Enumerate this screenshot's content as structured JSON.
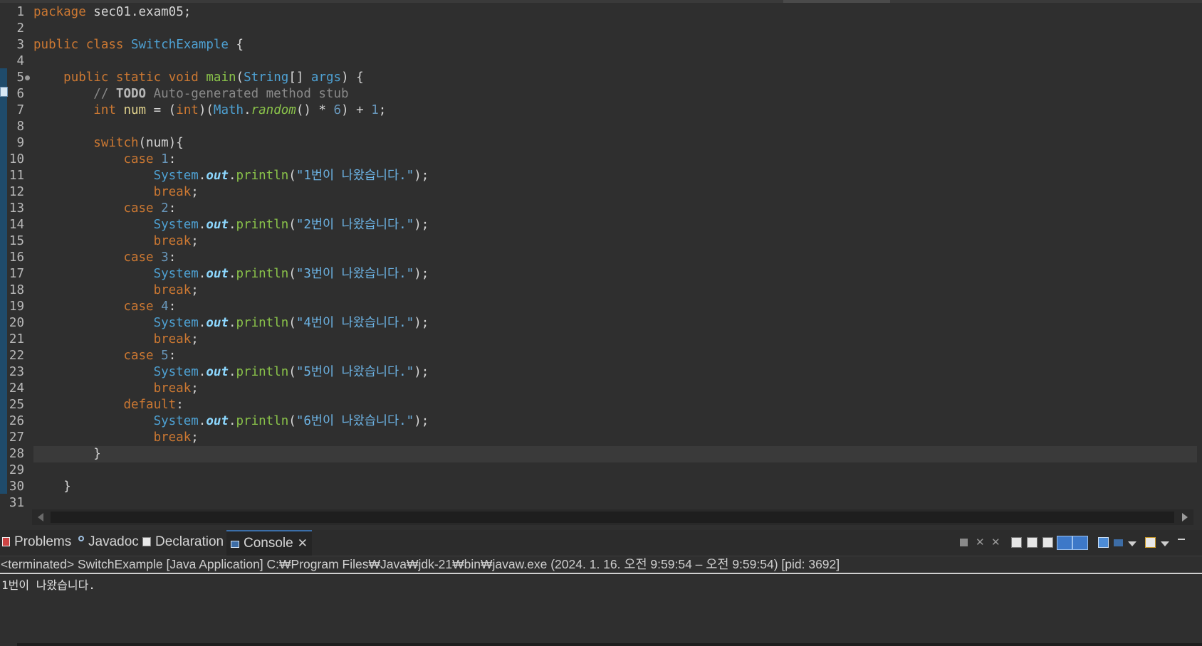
{
  "editor": {
    "lines": [
      {
        "n": "1",
        "tokens": [
          [
            "kw",
            "package"
          ],
          [
            "pl",
            " sec01.exam05;"
          ]
        ]
      },
      {
        "n": "2",
        "tokens": []
      },
      {
        "n": "3",
        "tokens": [
          [
            "kw",
            "public"
          ],
          [
            "pl",
            " "
          ],
          [
            "kw",
            "class"
          ],
          [
            "pl",
            " "
          ],
          [
            "cls",
            "SwitchExample"
          ],
          [
            "pl",
            " {"
          ]
        ]
      },
      {
        "n": "4",
        "tokens": []
      },
      {
        "n": "5",
        "marker": true,
        "tokens": [
          [
            "pl",
            "    "
          ],
          [
            "kw",
            "public"
          ],
          [
            "pl",
            " "
          ],
          [
            "kw",
            "static"
          ],
          [
            "pl",
            " "
          ],
          [
            "kw",
            "void"
          ],
          [
            "pl",
            " "
          ],
          [
            "meth",
            "main"
          ],
          [
            "pl",
            "("
          ],
          [
            "cls",
            "String"
          ],
          [
            "pl",
            "[] "
          ],
          [
            "cls",
            "args"
          ],
          [
            "pl",
            ") {"
          ]
        ]
      },
      {
        "n": "6",
        "tokens": [
          [
            "pl",
            "        "
          ],
          [
            "cmt",
            "// "
          ],
          [
            "todo",
            "TODO"
          ],
          [
            "cmt",
            " Auto-generated method stub"
          ]
        ]
      },
      {
        "n": "7",
        "tokens": [
          [
            "pl",
            "        "
          ],
          [
            "kw",
            "int"
          ],
          [
            "pl",
            " "
          ],
          [
            "var",
            "num"
          ],
          [
            "pl",
            " = ("
          ],
          [
            "kw",
            "int"
          ],
          [
            "pl",
            ")("
          ],
          [
            "cls",
            "Math"
          ],
          [
            "pl",
            "."
          ],
          [
            "smeth",
            "random"
          ],
          [
            "pl",
            "() * "
          ],
          [
            "num",
            "6"
          ],
          [
            "pl",
            ") + "
          ],
          [
            "num",
            "1"
          ],
          [
            "pl",
            ";"
          ]
        ]
      },
      {
        "n": "8",
        "tokens": []
      },
      {
        "n": "9",
        "tokens": [
          [
            "pl",
            "        "
          ],
          [
            "kw",
            "switch"
          ],
          [
            "pl",
            "(num){"
          ]
        ]
      },
      {
        "n": "10",
        "tokens": [
          [
            "pl",
            "            "
          ],
          [
            "kw",
            "case"
          ],
          [
            "pl",
            " "
          ],
          [
            "num",
            "1"
          ],
          [
            "pl",
            ":"
          ]
        ]
      },
      {
        "n": "11",
        "tokens": [
          [
            "pl",
            "                "
          ],
          [
            "cls",
            "System"
          ],
          [
            "pl",
            "."
          ],
          [
            "fld",
            "out"
          ],
          [
            "pl",
            "."
          ],
          [
            "meth",
            "println"
          ],
          [
            "pl",
            "("
          ],
          [
            "str",
            "\"1번이 나왔습니다.\""
          ],
          [
            "pl",
            ");"
          ]
        ]
      },
      {
        "n": "12",
        "tokens": [
          [
            "pl",
            "                "
          ],
          [
            "kw",
            "break"
          ],
          [
            "pl",
            ";"
          ]
        ]
      },
      {
        "n": "13",
        "tokens": [
          [
            "pl",
            "            "
          ],
          [
            "kw",
            "case"
          ],
          [
            "pl",
            " "
          ],
          [
            "num",
            "2"
          ],
          [
            "pl",
            ":"
          ]
        ]
      },
      {
        "n": "14",
        "tokens": [
          [
            "pl",
            "                "
          ],
          [
            "cls",
            "System"
          ],
          [
            "pl",
            "."
          ],
          [
            "fld",
            "out"
          ],
          [
            "pl",
            "."
          ],
          [
            "meth",
            "println"
          ],
          [
            "pl",
            "("
          ],
          [
            "str",
            "\"2번이 나왔습니다.\""
          ],
          [
            "pl",
            ");"
          ]
        ]
      },
      {
        "n": "15",
        "tokens": [
          [
            "pl",
            "                "
          ],
          [
            "kw",
            "break"
          ],
          [
            "pl",
            ";"
          ]
        ]
      },
      {
        "n": "16",
        "tokens": [
          [
            "pl",
            "            "
          ],
          [
            "kw",
            "case"
          ],
          [
            "pl",
            " "
          ],
          [
            "num",
            "3"
          ],
          [
            "pl",
            ":"
          ]
        ]
      },
      {
        "n": "17",
        "tokens": [
          [
            "pl",
            "                "
          ],
          [
            "cls",
            "System"
          ],
          [
            "pl",
            "."
          ],
          [
            "fld",
            "out"
          ],
          [
            "pl",
            "."
          ],
          [
            "meth",
            "println"
          ],
          [
            "pl",
            "("
          ],
          [
            "str",
            "\"3번이 나왔습니다.\""
          ],
          [
            "pl",
            ");"
          ]
        ]
      },
      {
        "n": "18",
        "tokens": [
          [
            "pl",
            "                "
          ],
          [
            "kw",
            "break"
          ],
          [
            "pl",
            ";"
          ]
        ]
      },
      {
        "n": "19",
        "tokens": [
          [
            "pl",
            "            "
          ],
          [
            "kw",
            "case"
          ],
          [
            "pl",
            " "
          ],
          [
            "num",
            "4"
          ],
          [
            "pl",
            ":"
          ]
        ]
      },
      {
        "n": "20",
        "tokens": [
          [
            "pl",
            "                "
          ],
          [
            "cls",
            "System"
          ],
          [
            "pl",
            "."
          ],
          [
            "fld",
            "out"
          ],
          [
            "pl",
            "."
          ],
          [
            "meth",
            "println"
          ],
          [
            "pl",
            "("
          ],
          [
            "str",
            "\"4번이 나왔습니다.\""
          ],
          [
            "pl",
            ");"
          ]
        ]
      },
      {
        "n": "21",
        "tokens": [
          [
            "pl",
            "                "
          ],
          [
            "kw",
            "break"
          ],
          [
            "pl",
            ";"
          ]
        ]
      },
      {
        "n": "22",
        "tokens": [
          [
            "pl",
            "            "
          ],
          [
            "kw",
            "case"
          ],
          [
            "pl",
            " "
          ],
          [
            "num",
            "5"
          ],
          [
            "pl",
            ":"
          ]
        ]
      },
      {
        "n": "23",
        "tokens": [
          [
            "pl",
            "                "
          ],
          [
            "cls",
            "System"
          ],
          [
            "pl",
            "."
          ],
          [
            "fld",
            "out"
          ],
          [
            "pl",
            "."
          ],
          [
            "meth",
            "println"
          ],
          [
            "pl",
            "("
          ],
          [
            "str",
            "\"5번이 나왔습니다.\""
          ],
          [
            "pl",
            ");"
          ]
        ]
      },
      {
        "n": "24",
        "tokens": [
          [
            "pl",
            "                "
          ],
          [
            "kw",
            "break"
          ],
          [
            "pl",
            ";"
          ]
        ]
      },
      {
        "n": "25",
        "tokens": [
          [
            "pl",
            "            "
          ],
          [
            "kw",
            "default"
          ],
          [
            "pl",
            ":"
          ]
        ]
      },
      {
        "n": "26",
        "tokens": [
          [
            "pl",
            "                "
          ],
          [
            "cls",
            "System"
          ],
          [
            "pl",
            "."
          ],
          [
            "fld",
            "out"
          ],
          [
            "pl",
            "."
          ],
          [
            "meth",
            "println"
          ],
          [
            "pl",
            "("
          ],
          [
            "str",
            "\"6번이 나왔습니다.\""
          ],
          [
            "pl",
            ");"
          ]
        ]
      },
      {
        "n": "27",
        "tokens": [
          [
            "pl",
            "                "
          ],
          [
            "kw",
            "break"
          ],
          [
            "pl",
            ";"
          ]
        ]
      },
      {
        "n": "28",
        "current": true,
        "tokens": [
          [
            "pl",
            "        }"
          ]
        ]
      },
      {
        "n": "29",
        "tokens": []
      },
      {
        "n": "30",
        "tokens": [
          [
            "pl",
            "    }"
          ]
        ]
      },
      {
        "n": "31",
        "tokens": []
      }
    ]
  },
  "views": {
    "tabs": [
      {
        "id": "problems",
        "label": "Problems",
        "icon": "problems-icon"
      },
      {
        "id": "javadoc",
        "label": "Javadoc",
        "icon": "javadoc-icon"
      },
      {
        "id": "declaration",
        "label": "Declaration",
        "icon": "declaration-icon"
      },
      {
        "id": "console",
        "label": "Console",
        "icon": "console-icon",
        "active": true
      }
    ],
    "close_glyph": "✕"
  },
  "console": {
    "header": "<terminated> SwitchExample [Java Application] C:₩Program Files₩Java₩jdk-21₩bin₩javaw.exe  (2024. 1. 16. 오전 9:59:54 – 오전 9:59:54) [pid: 3692]",
    "output": "1번이 나왔습니다."
  },
  "colors": {
    "background": "#2f2f2f",
    "keyword": "#cc7832",
    "class": "#4ea1d3",
    "method": "#8ac34a",
    "number": "#6897bb",
    "string": "#6cb3e4",
    "comment": "#8a8a8a",
    "active_tab_accent": "#3b6ea8"
  },
  "toolbar_icons": [
    "terminate-icon",
    "remove-launch-icon",
    "remove-all-terminated-icon",
    "scroll-lock-icon",
    "word-wrap-icon",
    "show-on-stdout-icon",
    "show-on-stderr-icon",
    "pin-console-icon",
    "display-selected-console-icon",
    "display-selected-console-menu-icon",
    "open-console-icon",
    "open-console-menu-icon"
  ]
}
